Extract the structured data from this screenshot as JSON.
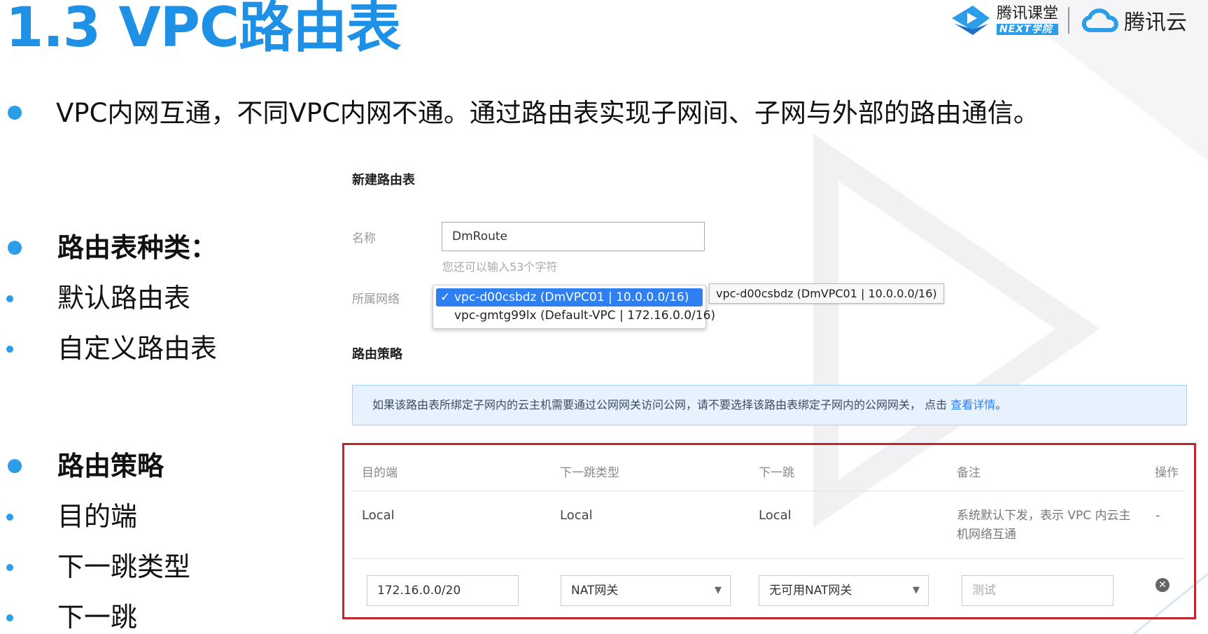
{
  "slide": {
    "title": "1.3 VPC路由表",
    "intro": "VPC内网互通，不同VPC内网不通。通过路由表实现子网间、子网与外部的路由通信。",
    "logos": {
      "tencent_class_main": "腾讯课堂",
      "tencent_class_sub": "NEXT学院",
      "tencent_cloud": "腾讯云"
    },
    "left_list": [
      {
        "text": "路由表种类：",
        "bold": true
      },
      {
        "text": "默认路由表",
        "bold": false
      },
      {
        "text": "自定义路由表",
        "bold": false
      },
      {
        "text": "路由策略",
        "bold": true
      },
      {
        "text": "目的端",
        "bold": false
      },
      {
        "text": "下一跳类型",
        "bold": false
      },
      {
        "text": "下一跳",
        "bold": false
      }
    ],
    "accent_color": "#2b9de9",
    "highlight_color": "#c0262d"
  },
  "form": {
    "heading": "新建路由表",
    "name_label": "名称",
    "name_value": "DmRoute",
    "name_hint": "您还可以输入53个字符",
    "network_label": "所属网络",
    "network_options": [
      "vpc-d00csbdz (DmVPC01 | 10.0.0.0/16)",
      "vpc-gmtg99lx (Default-VPC | 172.16.0.0/16)"
    ],
    "selected_option_tooltip": "vpc-d00csbdz (DmVPC01 | 10.0.0.0/16)",
    "policy_heading": "路由策略",
    "notice_text": "如果该路由表所绑定子网内的云主机需要通过公网网关访问公网，请不要选择该路由表绑定子网内的公网网关， 点击 ",
    "notice_link": "查看详情",
    "notice_end": "。"
  },
  "route_table": {
    "headers": [
      "目的端",
      "下一跳类型",
      "下一跳",
      "备注",
      "操作"
    ],
    "default_row": {
      "destination": "Local",
      "next_hop_type": "Local",
      "next_hop": "Local",
      "remark": "系统默认下发，表示 VPC 内云主机网络互通",
      "action": "-"
    },
    "edit_row": {
      "destination": "172.16.0.0/20",
      "next_hop_type": "NAT网关",
      "next_hop": "无可用NAT网关",
      "remark_placeholder": "测试"
    }
  }
}
